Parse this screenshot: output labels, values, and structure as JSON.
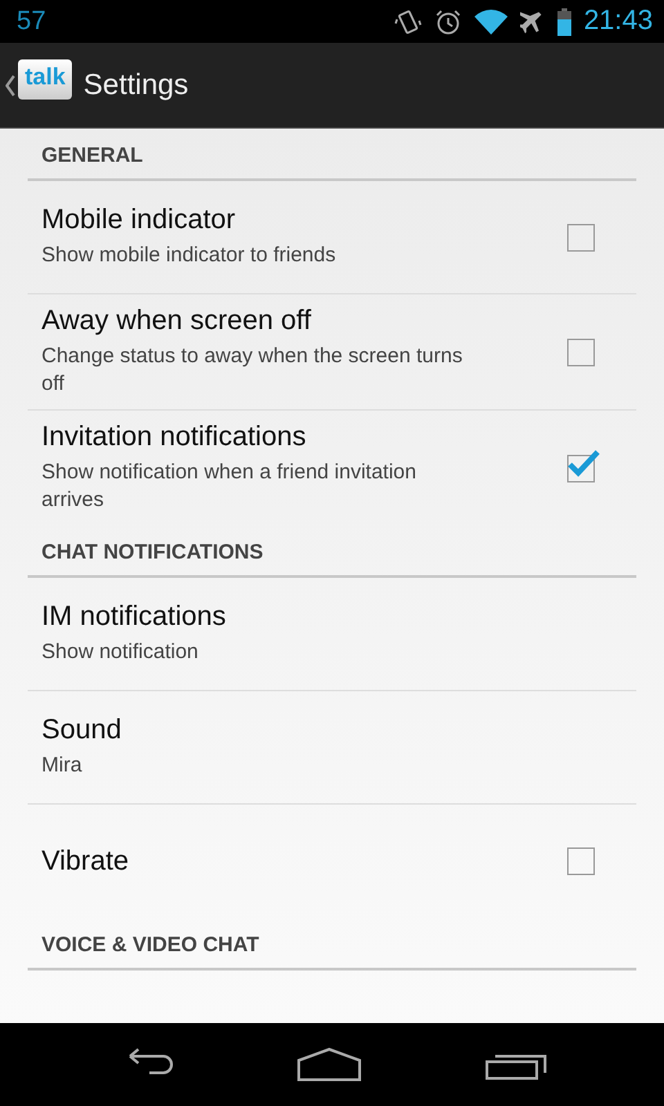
{
  "status_bar": {
    "notification": "57",
    "time": "21:43"
  },
  "action_bar": {
    "logo_text": "talk",
    "title": "Settings"
  },
  "sections": [
    {
      "header": "GENERAL",
      "items": [
        {
          "kind": "checkbox",
          "title": "Mobile indicator",
          "summary": "Show mobile indicator to friends",
          "checked": false
        },
        {
          "kind": "checkbox",
          "title": "Away when screen off",
          "summary": "Change status to away when the screen turns off",
          "checked": false
        },
        {
          "kind": "checkbox",
          "title": "Invitation notifications",
          "summary": "Show notification when a friend invitation arrives",
          "checked": true
        }
      ]
    },
    {
      "header": "CHAT NOTIFICATIONS",
      "items": [
        {
          "kind": "plain",
          "title": "IM notifications",
          "summary": "Show notification"
        },
        {
          "kind": "plain",
          "title": "Sound",
          "summary": "Mira"
        },
        {
          "kind": "checkbox",
          "title": "Vibrate",
          "checked": false
        }
      ]
    },
    {
      "header": "VOICE & VIDEO CHAT"
    }
  ]
}
